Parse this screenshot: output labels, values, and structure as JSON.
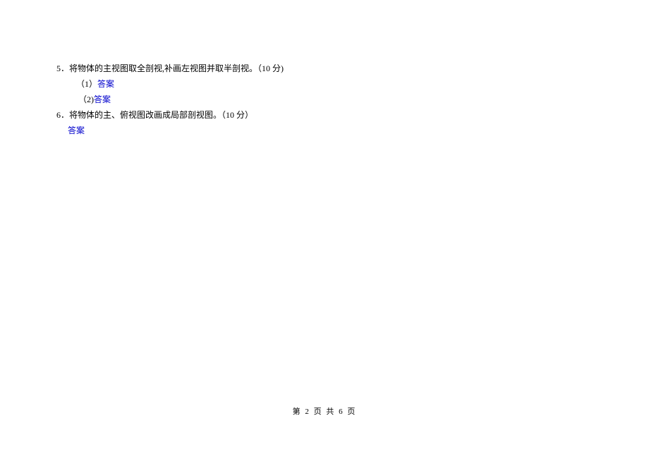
{
  "questions": {
    "q5": {
      "number": "5．",
      "text": "将物体的主视图取全剖视,补画左视图并取半剖视。（10 分)",
      "sub1_prefix": "（1）",
      "sub1_answer": "答案",
      "sub2_prefix": "（2)",
      "sub2_answer": "答案"
    },
    "q6": {
      "number": "6．",
      "text": "将物体的主、俯视图改画成局部剖视图。（10 分）",
      "answer": "答案"
    }
  },
  "footer": "第 2 页 共 6 页"
}
